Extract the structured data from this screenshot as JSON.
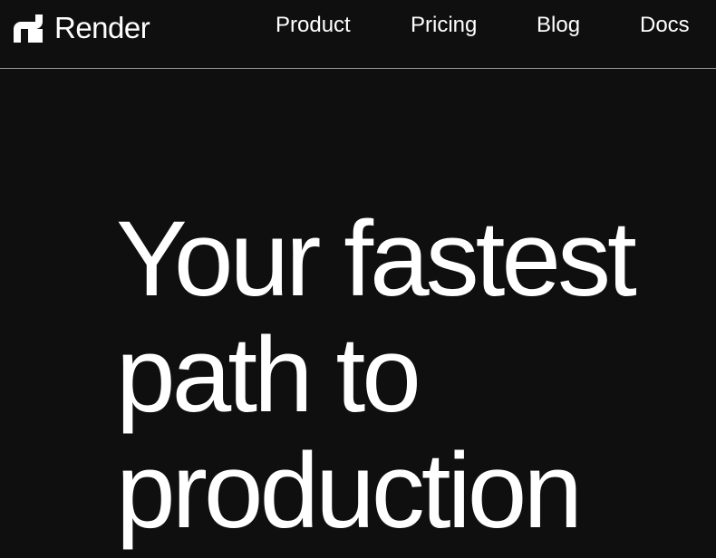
{
  "header": {
    "brand": {
      "name": "Render",
      "logo_icon": "render-logo-icon"
    },
    "nav": [
      {
        "label": "Product"
      },
      {
        "label": "Pricing"
      },
      {
        "label": "Blog"
      },
      {
        "label": "Docs"
      }
    ]
  },
  "hero": {
    "title_lines": [
      "Your fastest",
      "path to",
      "production"
    ]
  },
  "colors": {
    "background": "#0f0f0f",
    "text": "#ffffff",
    "divider": "#9a9a9a"
  }
}
